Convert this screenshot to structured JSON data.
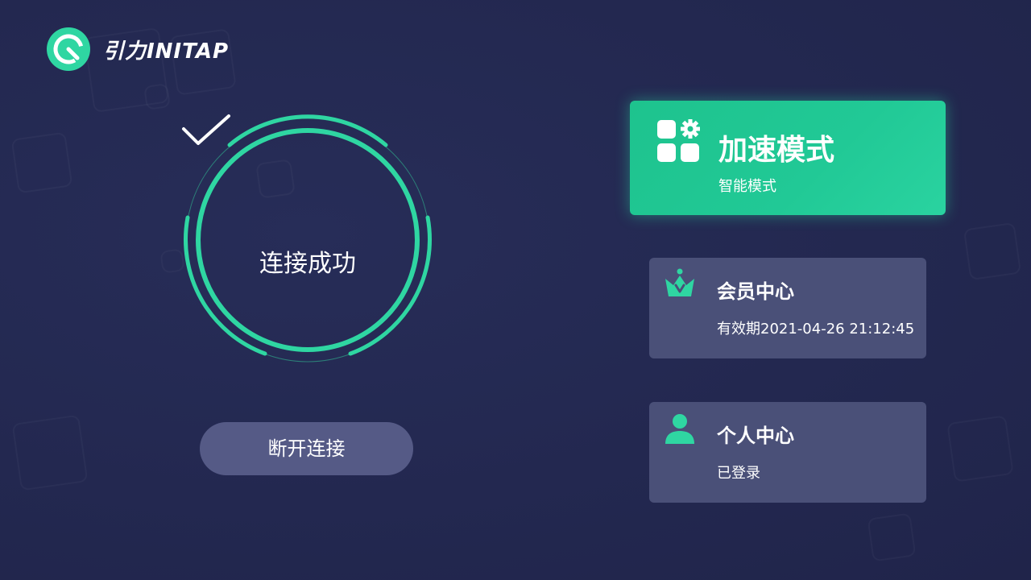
{
  "app": {
    "logo_text": "引力INITAP",
    "logo_icon": "gauge-icon",
    "accent_color": "#2fd6a2"
  },
  "connection": {
    "status_text": "连接成功",
    "status_icon": "checkmark-icon",
    "disconnect_label": "断开连接"
  },
  "mode_card": {
    "title": "加速模式",
    "subtitle": "智能模式",
    "icon": "apps-gear-icon",
    "color": "#1ec38e"
  },
  "member_card": {
    "title": "会员中心",
    "subtitle": "有效期2021-04-26 21:12:45",
    "icon": "crown-icon"
  },
  "profile_card": {
    "title": "个人中心",
    "subtitle": "已登录",
    "icon": "user-icon"
  }
}
